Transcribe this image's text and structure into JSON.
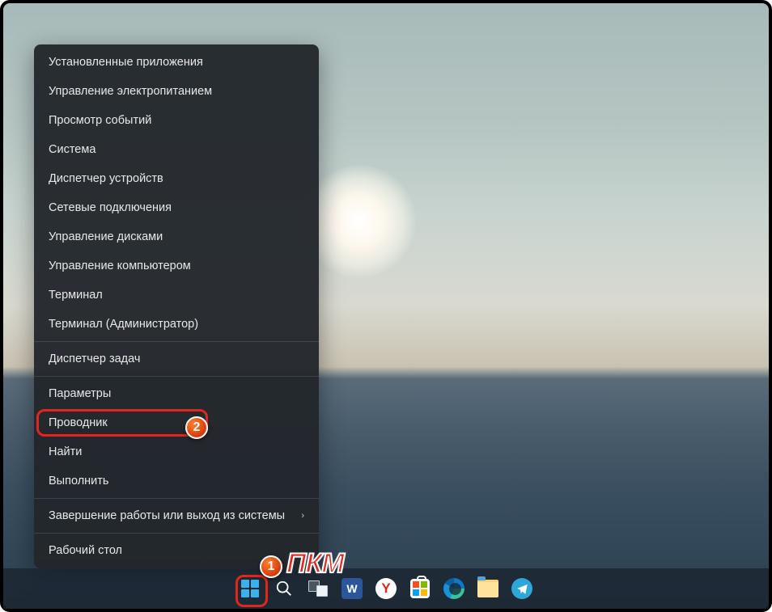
{
  "menu": {
    "groups": [
      [
        "Установленные приложения",
        "Управление электропитанием",
        "Просмотр событий",
        "Система",
        "Диспетчер устройств",
        "Сетевые подключения",
        "Управление дисками",
        "Управление компьютером",
        "Терминал",
        "Терминал (Администратор)"
      ],
      [
        "Диспетчер задач"
      ],
      [
        "Параметры",
        "Проводник",
        "Найти",
        "Выполнить"
      ],
      [
        "Завершение работы или выход из системы"
      ],
      [
        "Рабочий стол"
      ]
    ],
    "submenu_index": 3
  },
  "annotations": {
    "badge1": "1",
    "badge2": "2",
    "rmb_label": "ПКМ"
  },
  "taskbar": {
    "items": [
      "start",
      "search",
      "taskview",
      "word",
      "yandex",
      "store",
      "edge",
      "explorer",
      "telegram"
    ]
  }
}
